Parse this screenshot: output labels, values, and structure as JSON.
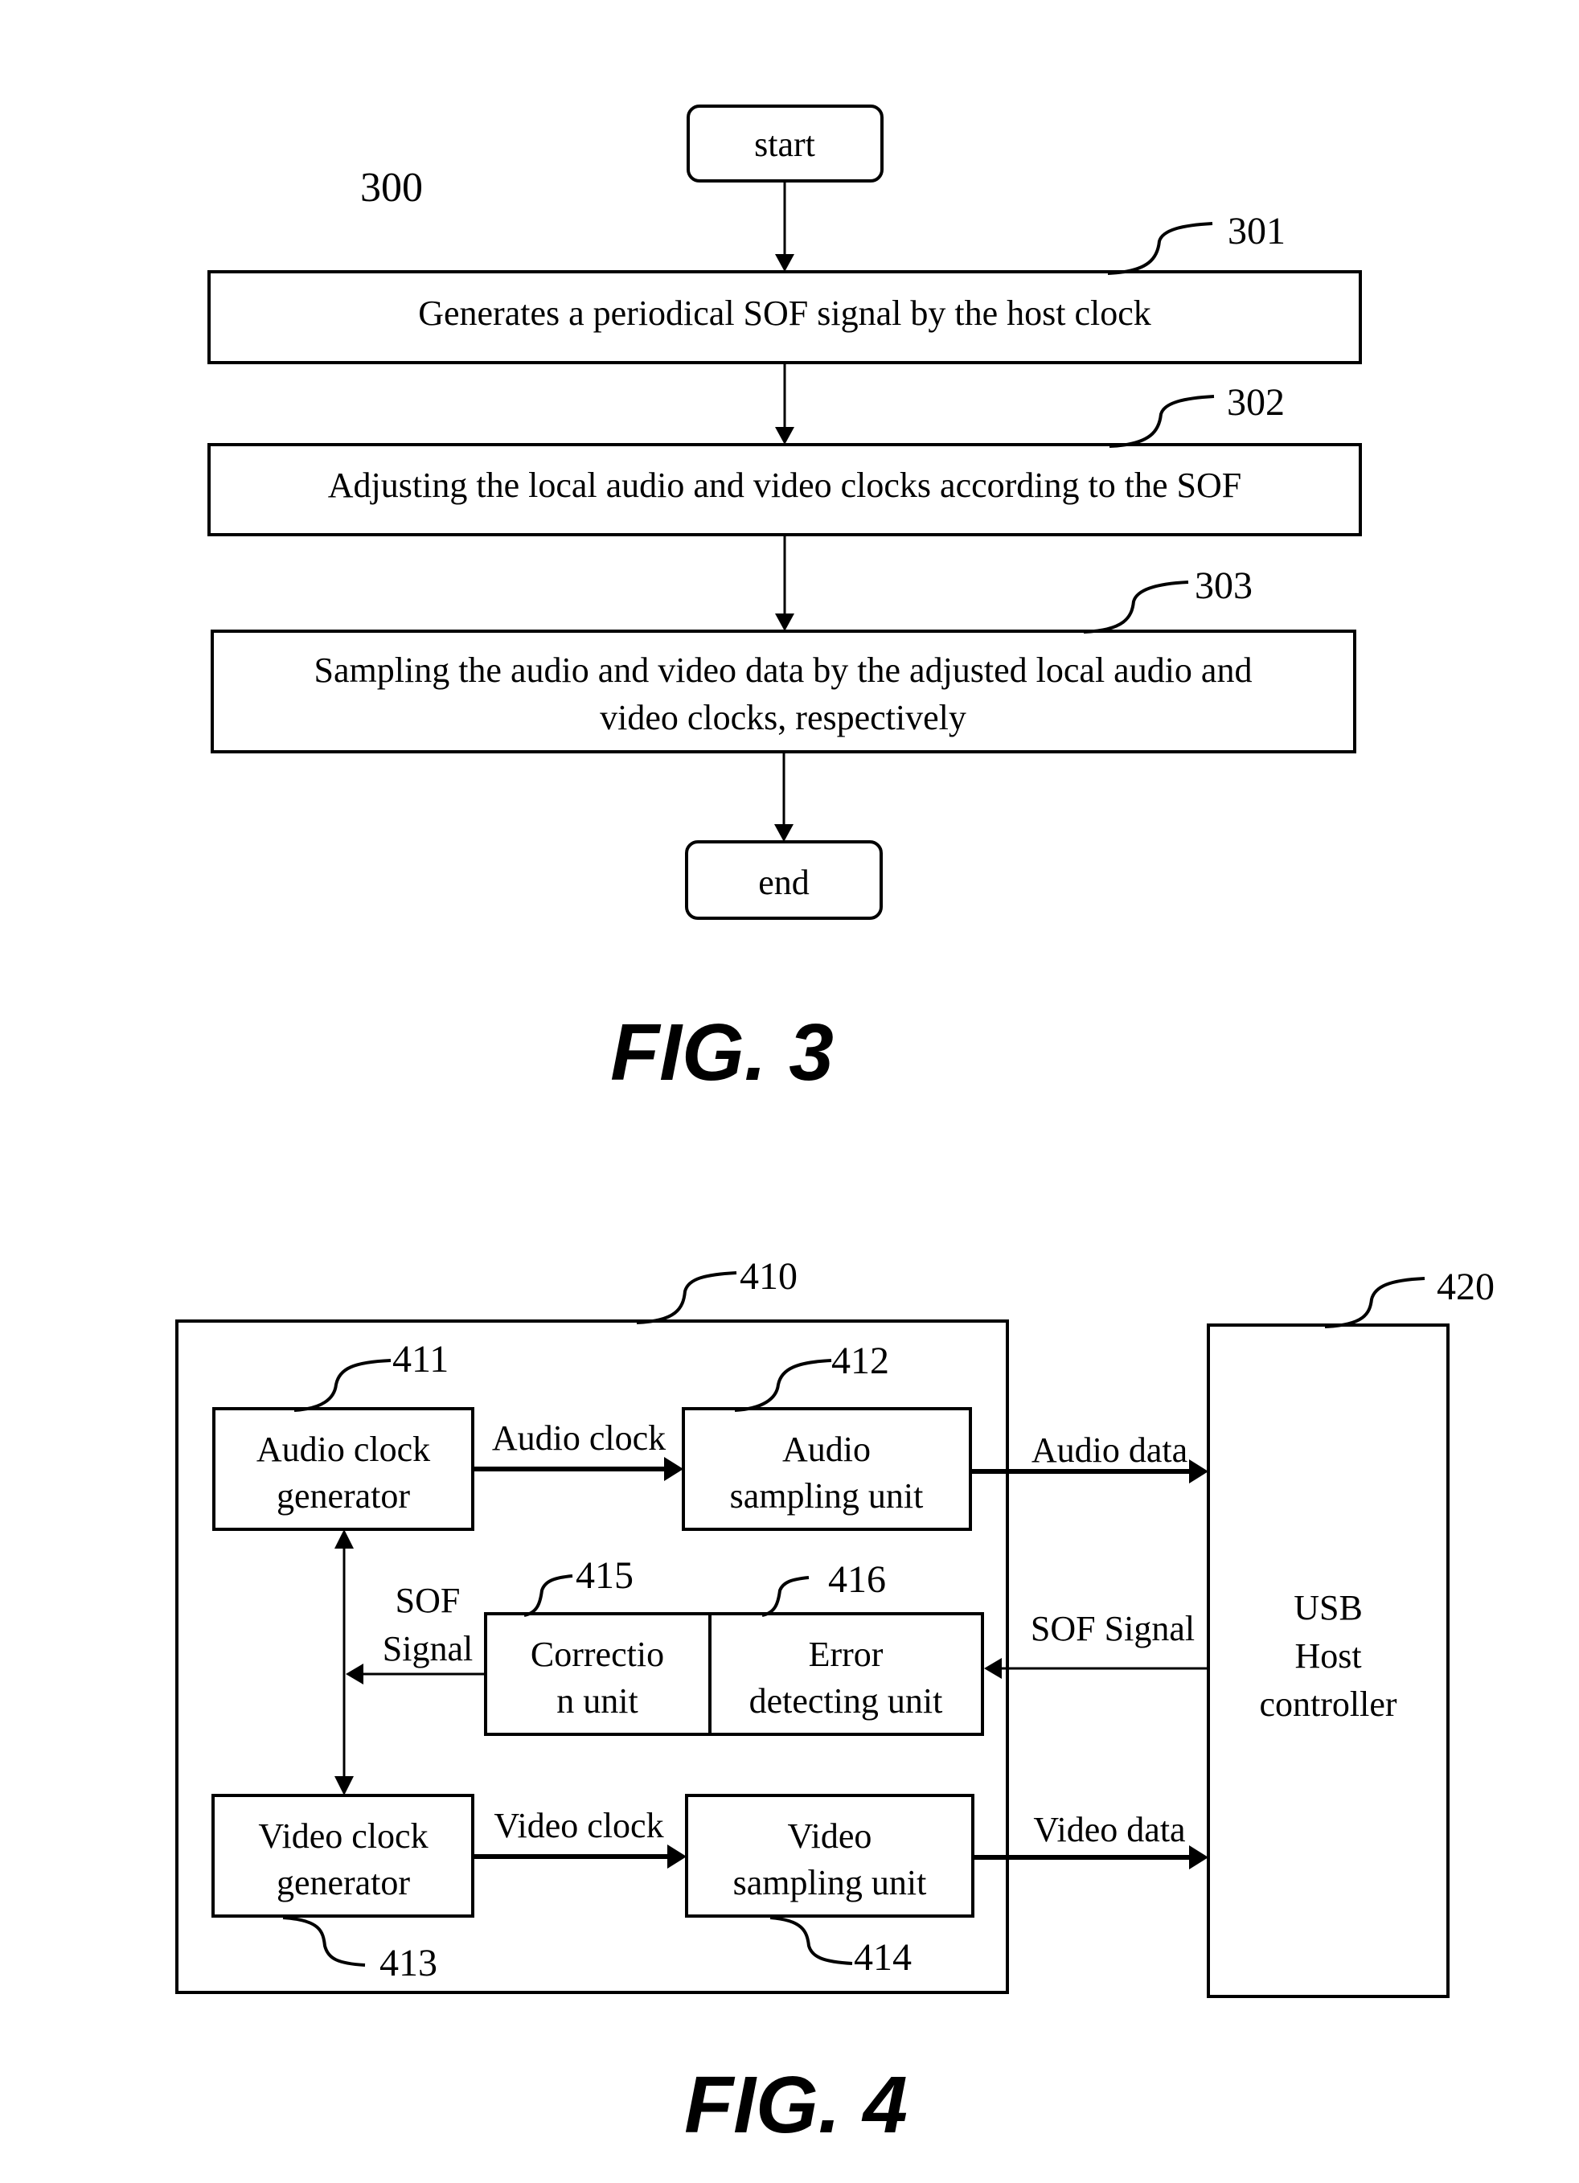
{
  "figure3": {
    "ref_number": "300",
    "start_label": "start",
    "end_label": "end",
    "steps": [
      {
        "ref": "301",
        "lines": [
          "Generates a periodical SOF signal by the host clock"
        ]
      },
      {
        "ref": "302",
        "lines": [
          "Adjusting the local audio and video clocks according to the SOF"
        ]
      },
      {
        "ref": "303",
        "lines": [
          "Sampling the audio and video data by the adjusted local audio and",
          "video clocks, respectively"
        ]
      }
    ],
    "caption": "FIG. 3"
  },
  "figure4": {
    "container": {
      "ref": "410"
    },
    "host": {
      "ref": "420",
      "lines": [
        "USB",
        "Host",
        "controller"
      ]
    },
    "blocks": {
      "audio_clock_generator": {
        "ref": "411",
        "lines": [
          "Audio clock",
          "generator"
        ]
      },
      "audio_sampling_unit": {
        "ref": "412",
        "lines": [
          "Audio",
          "sampling unit"
        ]
      },
      "video_clock_generator": {
        "ref": "413",
        "lines": [
          "Video clock",
          "generator"
        ]
      },
      "video_sampling_unit": {
        "ref": "414",
        "lines": [
          "Video",
          "sampling unit"
        ]
      },
      "correction_unit": {
        "ref": "415",
        "lines": [
          "Correctio",
          "n unit"
        ]
      },
      "error_detecting_unit": {
        "ref": "416",
        "lines": [
          "Error",
          "detecting unit"
        ]
      }
    },
    "signals": {
      "audio_clock": "Audio clock",
      "video_clock": "Video clock",
      "audio_data": "Audio data",
      "video_data": "Video data",
      "sof_signal_in": "SOF Signal",
      "sof_signal_out": [
        "SOF",
        "Signal"
      ]
    },
    "caption": "FIG. 4"
  }
}
